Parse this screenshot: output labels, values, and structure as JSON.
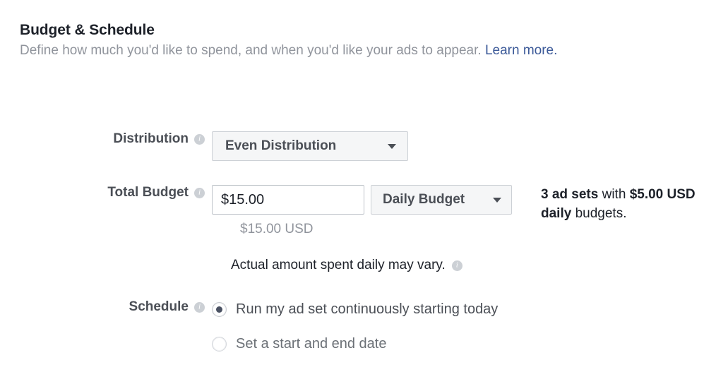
{
  "header": {
    "title": "Budget & Schedule",
    "subtitle_before": "Define how much you'd like to spend, and when you'd like your ads to appear. ",
    "link_label": "Learn more",
    "subtitle_after": "."
  },
  "fields": {
    "distribution": {
      "label": "Distribution",
      "selected_option": "Even Distribution",
      "options": [
        "Even Distribution"
      ]
    },
    "total_budget": {
      "label": "Total Budget",
      "amount_value": "$15.00",
      "amount_placeholder": "$15.00",
      "budget_type_selected": "Daily Budget",
      "budget_type_options": [
        "Daily Budget"
      ],
      "currency_note": "$15.00 USD",
      "vary_note": "Actual amount spent daily may vary."
    },
    "schedule": {
      "label": "Schedule",
      "options": [
        {
          "label": "Run my ad set continuously starting today",
          "selected": true
        },
        {
          "label": "Set a start and end date",
          "selected": false
        }
      ]
    }
  },
  "side_note": {
    "count_text": "3 ad sets",
    "with_text": " with ",
    "amount_text": "$5.00 USD daily",
    "tail_text": " budgets."
  },
  "icons": {
    "info": "info-icon",
    "caret": "chevron-down-icon"
  },
  "colors": {
    "link": "#3b5998",
    "label": "#4b4f56",
    "muted": "#90949c",
    "text": "#1d2129",
    "control_bg": "#f5f6f7",
    "border": "#ccd0d5"
  }
}
